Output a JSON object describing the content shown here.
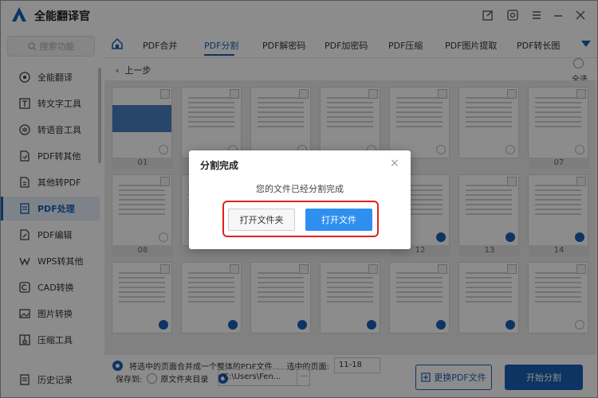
{
  "app": {
    "title": "全能翻译官",
    "colors": {
      "accent": "#1a5fb4",
      "primary_button": "#2f8ff0",
      "highlight": "#e02020"
    }
  },
  "sidebar": {
    "search_placeholder": "搜索功能",
    "items": [
      {
        "label": "全能翻译",
        "icon": "translate-icon"
      },
      {
        "label": "转文字工具",
        "icon": "text-tool-icon"
      },
      {
        "label": "转语音工具",
        "icon": "voice-tool-icon"
      },
      {
        "label": "PDF转其他",
        "icon": "pdf-convert-icon"
      },
      {
        "label": "其他转PDF",
        "icon": "to-pdf-icon"
      },
      {
        "label": "PDF处理",
        "icon": "pdf-process-icon",
        "active": true
      },
      {
        "label": "PDF编辑",
        "icon": "pdf-edit-icon"
      },
      {
        "label": "WPS转其他",
        "icon": "wps-icon"
      },
      {
        "label": "CAD转换",
        "icon": "cad-icon"
      },
      {
        "label": "图片转换",
        "icon": "image-icon"
      },
      {
        "label": "压缩工具",
        "icon": "compress-icon"
      }
    ],
    "history": "历史记录"
  },
  "tabs": [
    {
      "label": "PDF合并"
    },
    {
      "label": "PDF分割",
      "active": true
    },
    {
      "label": "PDF解密码"
    },
    {
      "label": "PDF加密码"
    },
    {
      "label": "PDF压缩"
    },
    {
      "label": "PDF图片提取"
    },
    {
      "label": "PDF转长图"
    }
  ],
  "content": {
    "back": "上一步",
    "select_all": "全选",
    "pages_row1": [
      "01",
      "",
      "",
      "",
      "",
      "",
      "07"
    ],
    "pages_row2": [
      "08",
      "",
      "",
      "",
      "12",
      "13",
      "14"
    ],
    "merge_option": "将选中的页面合并成一个整体的PDF文件",
    "selected_label": "选中的页面:",
    "selected_range": "11-18",
    "save_to": "保存到:",
    "save_option_original": "原文件夹目录",
    "save_path": "C:\\Users\\Fen...",
    "path_more": "···",
    "replace_button": "更换PDF文件",
    "start_button": "开始分割"
  },
  "dialog": {
    "title": "分割完成",
    "message": "您的文件已经分割完成",
    "open_folder": "打开文件夹",
    "open_file": "打开文件",
    "close": "×"
  }
}
